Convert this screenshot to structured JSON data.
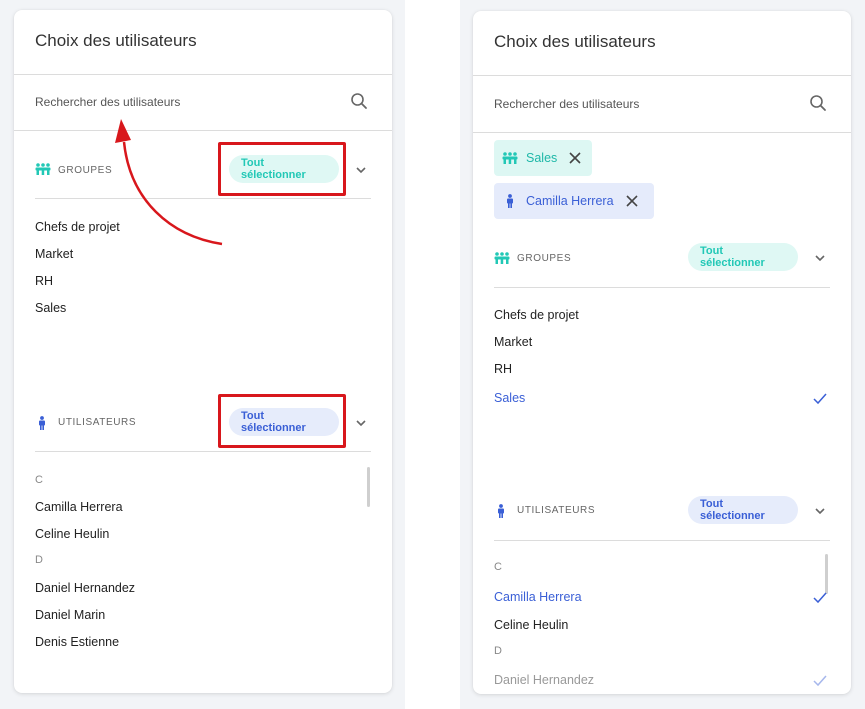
{
  "left": {
    "title": "Choix des utilisateurs",
    "search_placeholder": "Rechercher des utilisateurs",
    "groups_label": "GROUPES",
    "groups_select_all": "Tout sélectionner",
    "groups": [
      "Chefs de projet",
      "Market",
      "RH",
      "Sales"
    ],
    "users_label": "UTILISATEURS",
    "users_select_all": "Tout sélectionner",
    "letter_c": "C",
    "letter_d": "D",
    "users_c": [
      "Camilla Herrera",
      "Celine Heulin"
    ],
    "users_d": [
      "Daniel Hernandez",
      "Daniel Marin",
      "Denis Estienne"
    ]
  },
  "right": {
    "title": "Choix des utilisateurs",
    "search_placeholder": "Rechercher des utilisateurs",
    "chips": [
      "Sales",
      "Camilla Herrera"
    ],
    "groups_label": "GROUPES",
    "groups_select_all": "Tout sélectionner",
    "groups": [
      "Chefs de projet",
      "Market",
      "RH",
      "Sales"
    ],
    "users_label": "UTILISATEURS",
    "users_select_all": "Tout sélectionner",
    "letter_c": "C",
    "letter_d": "D",
    "users_c": [
      "Camilla Herrera",
      "Celine Heulin"
    ],
    "users_d": [
      "Daniel Hernandez"
    ]
  },
  "colors": {
    "teal": "#22c8b6",
    "blue": "#3a5fd6",
    "annotation_red": "#d8171c"
  }
}
